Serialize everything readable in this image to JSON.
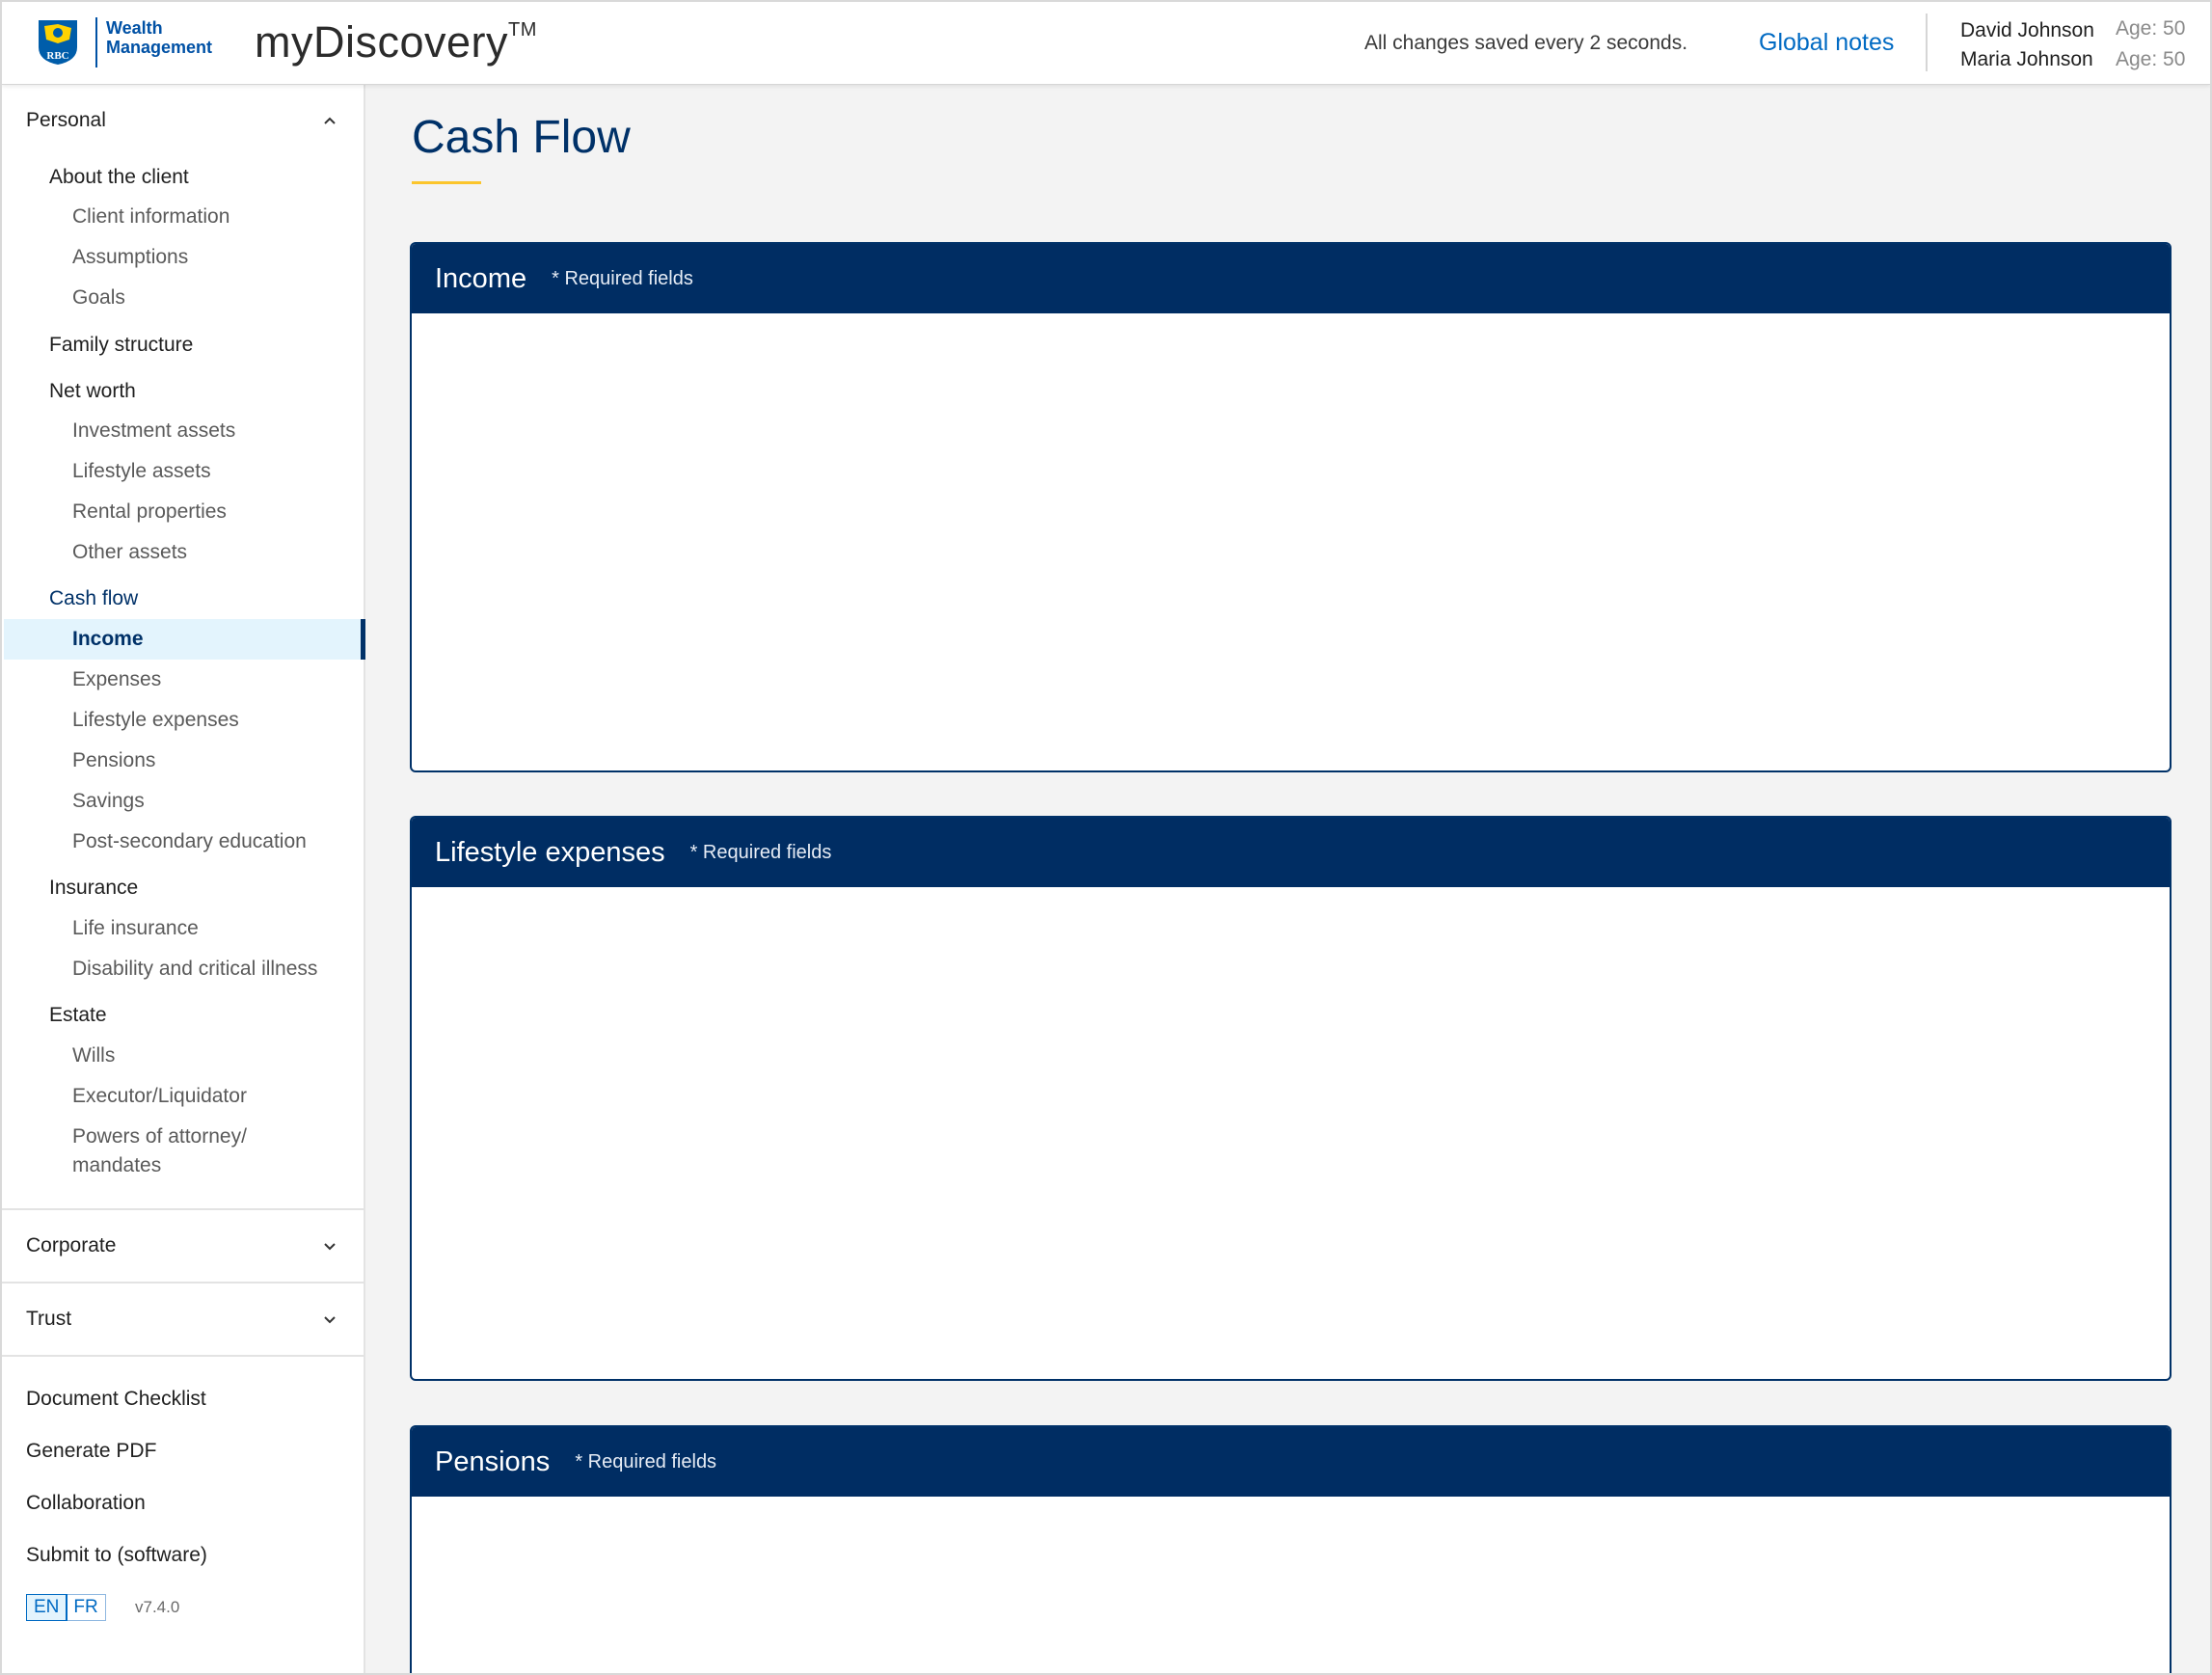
{
  "header": {
    "logo_line1": "Wealth",
    "logo_line2": "Management",
    "logo_badge": "RBC",
    "app_name": "myDiscovery",
    "app_trademark": "TM",
    "save_status": "All changes saved every 2 seconds.",
    "global_notes": "Global notes",
    "clients": [
      {
        "name": "David Johnson",
        "age": "Age: 50"
      },
      {
        "name": "Maria Johnson",
        "age": "Age: 50"
      }
    ]
  },
  "sidebar": {
    "personal": "Personal",
    "about": "About the client",
    "client_information": "Client information",
    "assumptions": "Assumptions",
    "goals": "Goals",
    "family_structure": "Family structure",
    "net_worth": "Net worth",
    "investment_assets": "Investment assets",
    "lifestyle_assets": "Lifestyle assets",
    "rental_properties": "Rental properties",
    "other_assets": "Other assets",
    "cash_flow": "Cash flow",
    "income": "Income",
    "expenses": "Expenses",
    "lifestyle_expenses": "Lifestyle expenses",
    "pensions": "Pensions",
    "savings": "Savings",
    "post_secondary": "Post-secondary education",
    "insurance": "Insurance",
    "life_insurance": "Life insurance",
    "disability": "Disability and critical illness",
    "estate": "Estate",
    "wills": "Wills",
    "executor": "Executor/Liquidator",
    "powers_line1": "Powers of attorney/",
    "powers_line2": "mandates",
    "corporate": "Corporate",
    "trust": "Trust",
    "document_checklist": "Document Checklist",
    "generate_pdf": "Generate PDF",
    "collaboration": "Collaboration",
    "submit": "Submit to (software)",
    "lang_en": "EN",
    "lang_fr": "FR",
    "version": "v7.4.0"
  },
  "main": {
    "title": "Cash Flow",
    "cards": [
      {
        "title": "Income",
        "required": "* Required fields"
      },
      {
        "title": "Lifestyle expenses",
        "required": "* Required fields"
      },
      {
        "title": "Pensions",
        "required": "* Required fields"
      }
    ]
  },
  "colors": {
    "navy": "#003168",
    "card_header": "#002d63",
    "link_blue": "#006ac3",
    "accent_gold": "#fbc52c",
    "selected_bg": "#e3f4fd"
  }
}
